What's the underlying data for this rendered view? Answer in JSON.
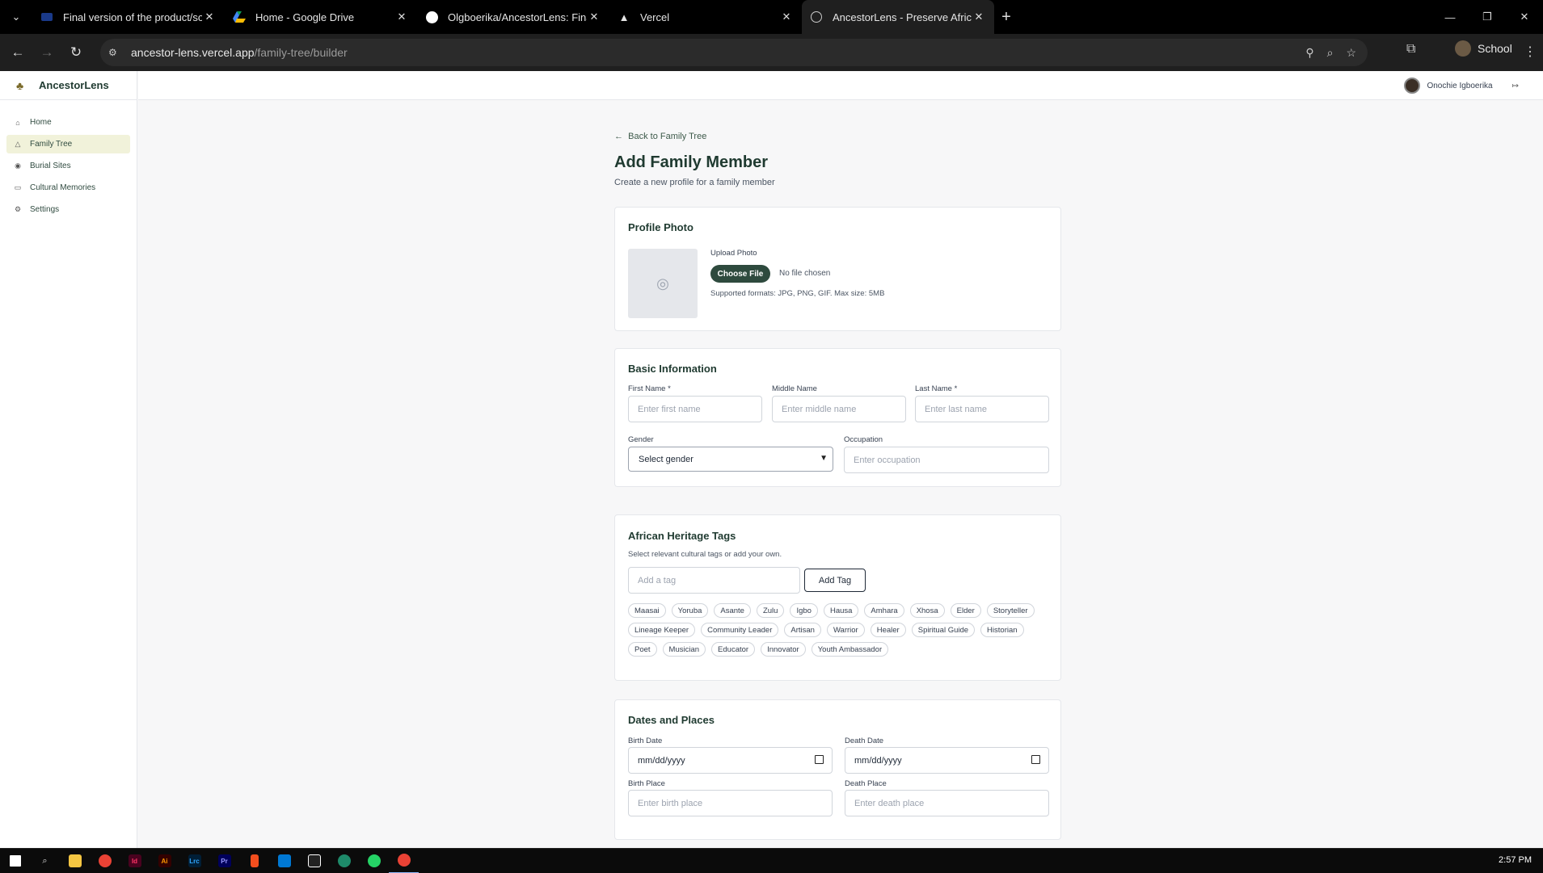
{
  "browser": {
    "tabs": [
      {
        "title": "Final version of the product/sol",
        "active": false
      },
      {
        "title": "Home - Google Drive",
        "active": false
      },
      {
        "title": "Olgboerika/AncestorLens: Final",
        "active": false
      },
      {
        "title": "Vercel",
        "active": false
      },
      {
        "title": "AncestorLens - Preserve African",
        "active": true
      }
    ],
    "url_host": "ancestor-lens.vercel.app",
    "url_path": "/family-tree/builder",
    "profile_label": "School"
  },
  "app": {
    "brand": "AncestorLens",
    "nav": [
      {
        "label": "Home",
        "icon": "home-icon",
        "active": false
      },
      {
        "label": "Family Tree",
        "icon": "tree-icon",
        "active": true
      },
      {
        "label": "Burial Sites",
        "icon": "map-pin-icon",
        "active": false
      },
      {
        "label": "Cultural Memories",
        "icon": "book-icon",
        "active": false
      },
      {
        "label": "Settings",
        "icon": "gear-icon",
        "active": false
      }
    ],
    "user_name": "Onochie Igboerika"
  },
  "page": {
    "back_link": "Back to Family Tree",
    "title": "Add Family Member",
    "subtitle": "Create a new profile for a family member"
  },
  "profile_photo": {
    "heading": "Profile Photo",
    "upload_label": "Upload Photo",
    "choose_button": "Choose File",
    "no_file": "No file chosen",
    "supported": "Supported formats: JPG, PNG, GIF. Max size: 5MB"
  },
  "basic_info": {
    "heading": "Basic Information",
    "first_name_label": "First Name *",
    "first_name_placeholder": "Enter first name",
    "middle_name_label": "Middle Name",
    "middle_name_placeholder": "Enter middle name",
    "last_name_label": "Last Name *",
    "last_name_placeholder": "Enter last name",
    "gender_label": "Gender",
    "gender_value": "Select gender",
    "occupation_label": "Occupation",
    "occupation_placeholder": "Enter occupation"
  },
  "heritage": {
    "heading": "African Heritage Tags",
    "subtitle": "Select relevant cultural tags or add your own.",
    "input_placeholder": "Add a tag",
    "add_button": "Add Tag",
    "tags": [
      "Maasai",
      "Yoruba",
      "Asante",
      "Zulu",
      "Igbo",
      "Hausa",
      "Amhara",
      "Xhosa",
      "Elder",
      "Storyteller",
      "Lineage Keeper",
      "Community Leader",
      "Artisan",
      "Warrior",
      "Healer",
      "Spiritual Guide",
      "Historian",
      "Poet",
      "Musician",
      "Educator",
      "Innovator",
      "Youth Ambassador"
    ]
  },
  "dates_places": {
    "heading": "Dates and Places",
    "birth_date_label": "Birth Date",
    "birth_date_value": "mm/dd/yyyy",
    "death_date_label": "Death Date",
    "death_date_value": "mm/dd/yyyy",
    "birth_place_label": "Birth Place",
    "birth_place_placeholder": "Enter birth place",
    "death_place_label": "Death Place",
    "death_place_placeholder": "Enter death place"
  },
  "taskbar": {
    "clock": "2:57 PM",
    "apps": [
      "start-icon",
      "search-icon",
      "file-explorer-icon",
      "chrome-icon",
      "indesign-icon",
      "illustrator-icon",
      "lightroom-icon",
      "premiere-icon",
      "figma-icon",
      "vscode-icon",
      "capcut-icon",
      "app-icon",
      "whatsapp-icon",
      "chrome-active-icon"
    ]
  }
}
